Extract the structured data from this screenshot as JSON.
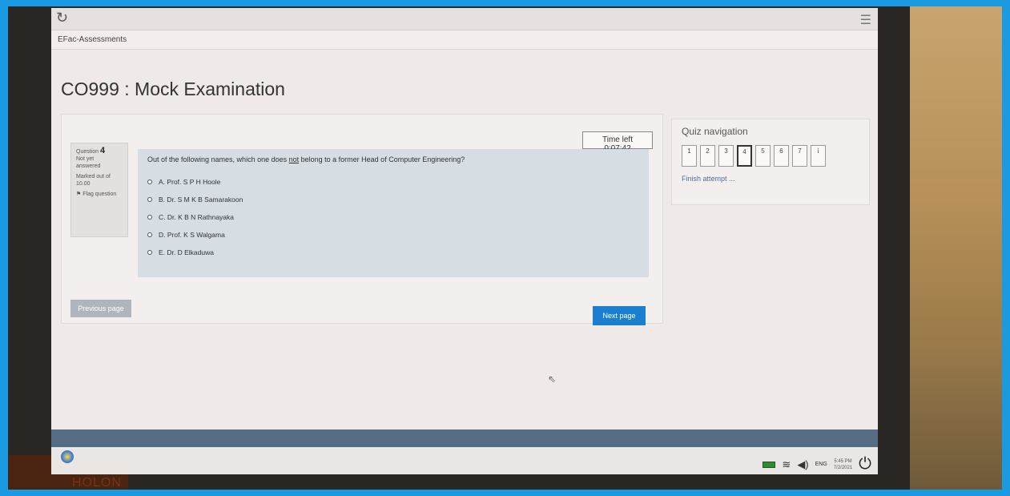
{
  "browser": {
    "menu_glyph": "☰",
    "reload_glyph": "↻"
  },
  "site": {
    "name": "EFac-Assessments"
  },
  "page": {
    "title": "CO999 : Mock Examination"
  },
  "timer": {
    "text": "Time left 0:07:42"
  },
  "question": {
    "label": "Question",
    "number": "4",
    "status_line1": "Not yet",
    "status_line2": "answered",
    "marked_line1": "Marked out of",
    "marked_line2": "10.00",
    "flag_label": "Flag question",
    "text_before": "Out of the following names, which one does ",
    "text_emphasis": "not",
    "text_after": " belong to a former Head of Computer Engineering?",
    "options": [
      "A. Prof. S P H  Hoole",
      "B. Dr. S M K B Samarakoon",
      "C. Dr. K B N Rathnayaka",
      "D. Prof. K S Walgama",
      "E. Dr. D Elkaduwa"
    ]
  },
  "buttons": {
    "previous": "Previous page",
    "next": "Next page"
  },
  "quiz_nav": {
    "title": "Quiz navigation",
    "items": [
      "1",
      "2",
      "3",
      "4",
      "5",
      "6",
      "7",
      "i"
    ],
    "current": "4",
    "finish": "Finish attempt ..."
  },
  "taskbar": {
    "lang": "ENG",
    "time": "5:45 PM",
    "date": "7/2/2021"
  },
  "desk": {
    "text": "HOLON"
  }
}
